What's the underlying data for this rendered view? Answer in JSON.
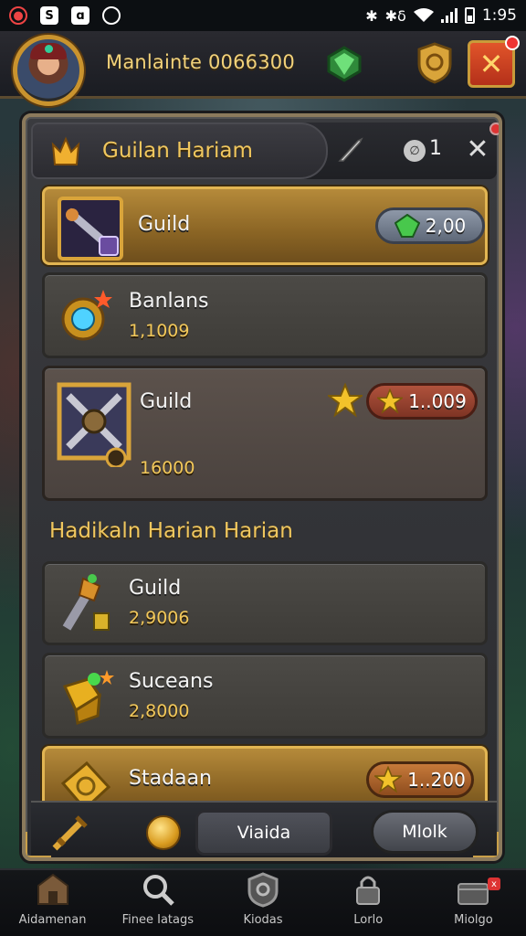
{
  "status_bar": {
    "time": "1:95",
    "bluetooth": "✱",
    "network": "✱δ"
  },
  "header": {
    "player_name": "Manlainte 0066300",
    "icons": [
      "avatar",
      "green-gem-icon",
      "shield-icon",
      "close-icon"
    ]
  },
  "panel": {
    "title": "Guilan Hariam",
    "counter_badge": "∅",
    "counter_value": "1",
    "close_label": "✕"
  },
  "rows": [
    {
      "label": "Guild",
      "value": "",
      "pill": "2,00",
      "pill_icon": "green-gem-icon",
      "style": "gold"
    },
    {
      "label": "Banlans",
      "value": "1,1009",
      "style": "normal"
    },
    {
      "label": "Guild",
      "value": "16000",
      "pill": "1..009",
      "pill_icon": "star-icon",
      "style": "brown"
    }
  ],
  "section": {
    "title": "Hadikaln Harian Harian"
  },
  "rows2": [
    {
      "label": "Guild",
      "value": "2,9006",
      "style": "normal"
    },
    {
      "label": "Suceans",
      "value": "2,8000",
      "style": "normal"
    },
    {
      "label": "Stadaan",
      "value": "",
      "pill": "1..200",
      "pill_icon": "star-icon",
      "style": "gold"
    }
  ],
  "action_bar": {
    "tab_label": "Viaida",
    "right_label": "Mlolk"
  },
  "bottom_nav": [
    {
      "label": "Aidamenan",
      "icon": "castle-icon"
    },
    {
      "label": "Finee Iatags",
      "icon": "search-icon"
    },
    {
      "label": "Kiodas",
      "icon": "shield-icon"
    },
    {
      "label": "Lorlo",
      "icon": "lock-icon"
    },
    {
      "label": "Miolgo",
      "icon": "chest-icon",
      "badge": "x"
    }
  ],
  "colors": {
    "gold": "#f0c75e",
    "panel_border": "#8b7a5c",
    "close_red": "#e2552a"
  }
}
